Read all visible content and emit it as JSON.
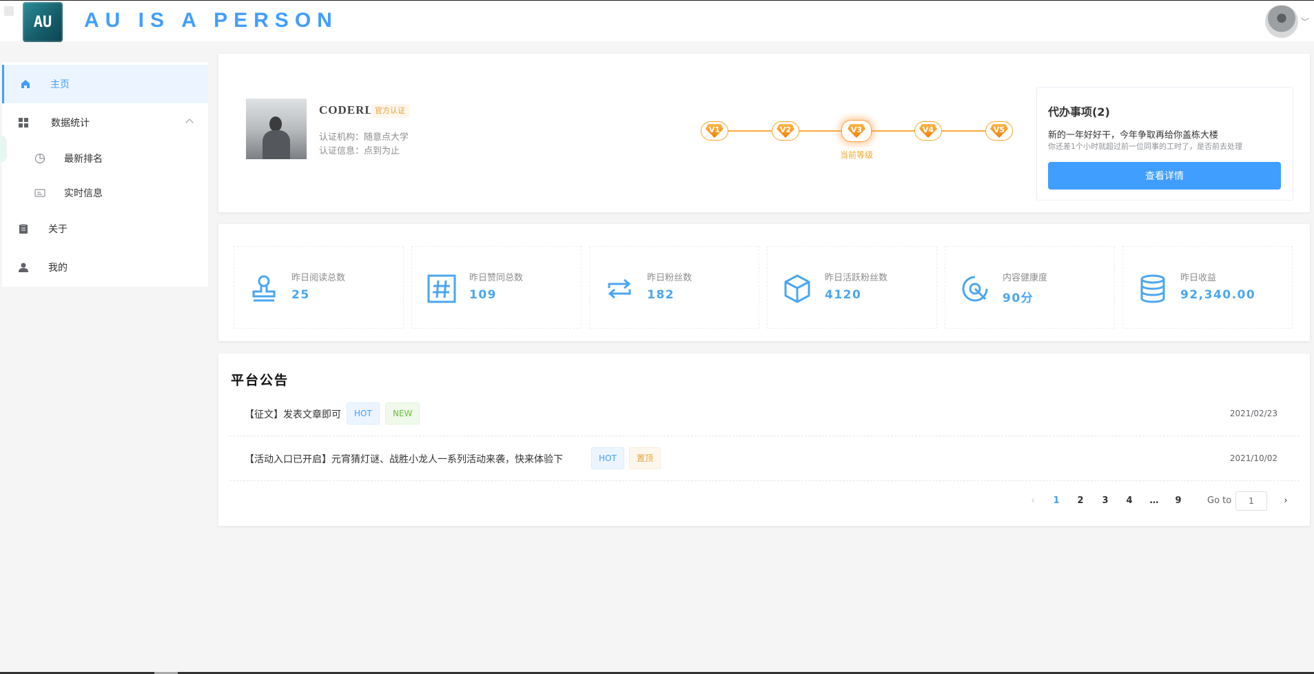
{
  "header": {
    "logo_text": "AU",
    "brand": "AU IS A PERSON"
  },
  "sidebar": {
    "items": [
      {
        "label": "主页",
        "icon": "home-icon"
      },
      {
        "label": "数据统计",
        "icon": "grid-icon"
      },
      {
        "label": "最新排名",
        "icon": "pie-chart-icon"
      },
      {
        "label": "实时信息",
        "icon": "id-card-icon"
      },
      {
        "label": "关于",
        "icon": "clipboard-icon"
      },
      {
        "label": "我的",
        "icon": "user-icon"
      }
    ]
  },
  "profile": {
    "name": "CODERLY",
    "badge": "官方认证",
    "org": "认证机构：随意点大学",
    "info": "认证信息：点到为止",
    "levels": [
      "V1",
      "V2",
      "V3",
      "V4",
      "V5"
    ],
    "current_level": "V3",
    "current_caption": "当前等级"
  },
  "todo": {
    "title": "代办事项(2)",
    "line1": "新的一年好好干，今年争取再给你盖栋大楼",
    "line2": "你还差1个小时就超过前一位同事的工时了，是否前去处理",
    "button": "查看详情"
  },
  "stats": [
    {
      "label": "昨日阅读总数",
      "value": "25",
      "icon": "stamp-icon"
    },
    {
      "label": "昨日赞同总数",
      "value": "109",
      "icon": "hash-icon"
    },
    {
      "label": "昨日粉丝数",
      "value": "182",
      "icon": "repeat-icon"
    },
    {
      "label": "昨日活跃粉丝数",
      "value": "4120",
      "icon": "cube-icon"
    },
    {
      "label": "内容健康度",
      "value": "90分",
      "icon": "target-icon"
    },
    {
      "label": "昨日收益",
      "value": "92,340.00",
      "icon": "database-icon"
    }
  ],
  "notice": {
    "title": "平台公告",
    "rows": [
      {
        "text": "【征文】发表文章即可",
        "tags": [
          "HOT",
          "NEW"
        ],
        "date": "2021/02/23"
      },
      {
        "text": "【活动入口已开启】元宵猜灯谜、战胜小龙人一系列活动来袭，快来体验下",
        "tags": [
          "HOT",
          "置顶"
        ],
        "date": "2021/10/02"
      }
    ],
    "pagination": {
      "pages": [
        "1",
        "2",
        "3",
        "4",
        "…",
        "9"
      ],
      "current": "1",
      "goto_label": "Go to",
      "goto_value": "1"
    }
  },
  "colors": {
    "primary": "#409eff",
    "warning": "#e6a23c",
    "success": "#67c23a",
    "stat_icon": "#4aa6f0"
  }
}
